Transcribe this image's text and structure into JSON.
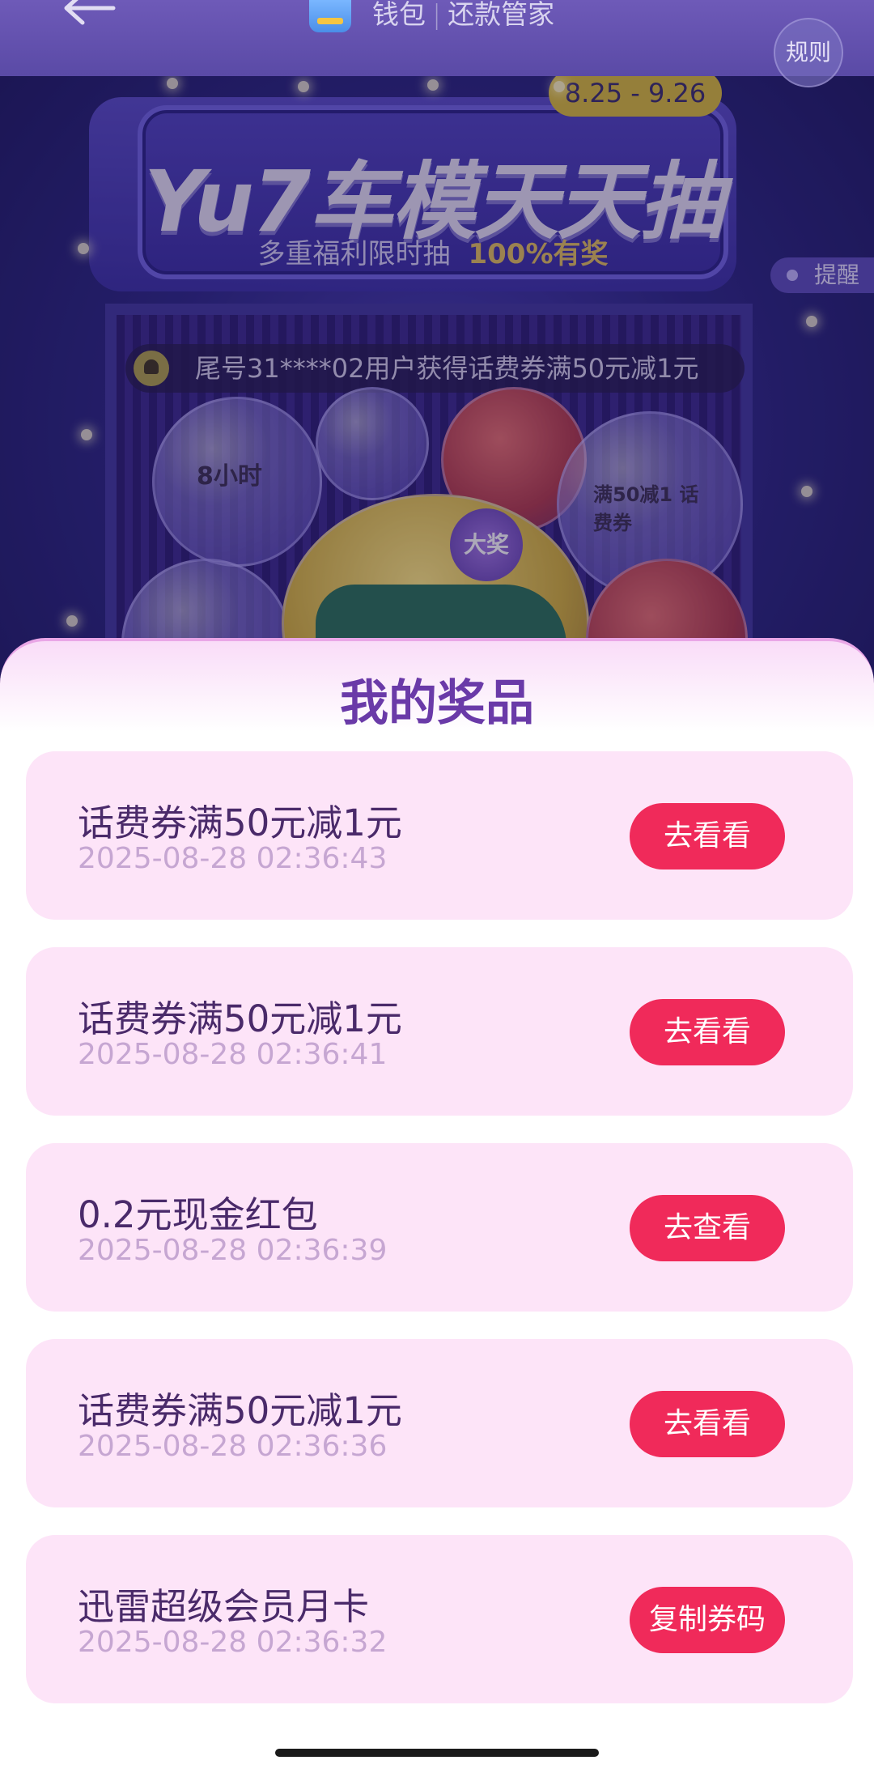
{
  "topbar": {
    "app_name": "钱包",
    "section_name": "还款管家",
    "rules_label": "规则",
    "back_icon": "arrow-left-icon",
    "wallet_icon": "wallet-icon"
  },
  "banner": {
    "date_range": "8.25 - 9.26",
    "title": "Yu7车模天天抽",
    "subtitle": "多重福利限时抽",
    "subtitle_highlight": "100%有奖",
    "remind_label": "提醒",
    "notice_text": "尾号31****02用户获得话费券满50元减1元",
    "big_prize_badge": "大奖",
    "capsule_card_vip_hours": "8小时",
    "capsule_card_coupon": "满50减1 话费券"
  },
  "sheet": {
    "title": "我的奖品",
    "prizes": [
      {
        "name": "话费券满50元减1元",
        "time": "2025-08-28 02:36:43",
        "action": "去看看"
      },
      {
        "name": "话费券满50元减1元",
        "time": "2025-08-28 02:36:41",
        "action": "去看看"
      },
      {
        "name": "0.2元现金红包",
        "time": "2025-08-28 02:36:39",
        "action": "去查看"
      },
      {
        "name": "话费券满50元减1元",
        "time": "2025-08-28 02:36:36",
        "action": "去看看"
      },
      {
        "name": "迅雷超级会员月卡",
        "time": "2025-08-28 02:36:32",
        "action": "复制券码"
      }
    ]
  },
  "colors": {
    "accent_button": "#f02a5a",
    "card_background": "#fde4f8",
    "title_purple": "#6a3aa8"
  }
}
